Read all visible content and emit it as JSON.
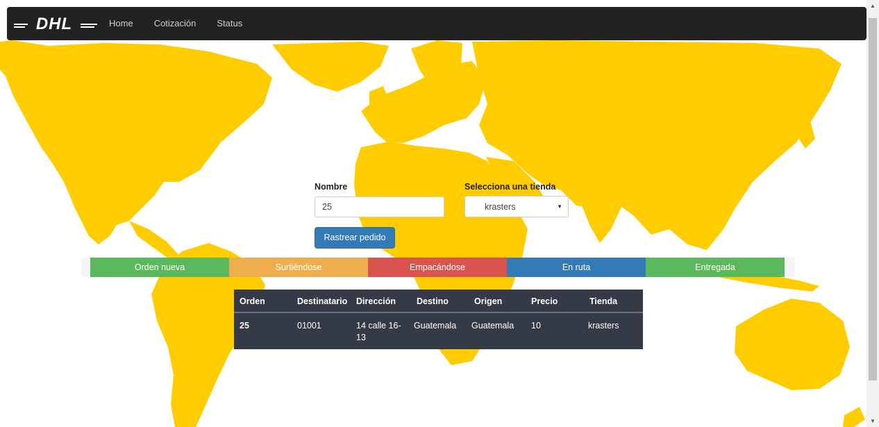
{
  "navbar": {
    "brand": "DHL",
    "links": [
      "Home",
      "Cotización",
      "Status"
    ]
  },
  "form": {
    "name_label": "Nombre",
    "name_value": "25",
    "store_label": "Selecciona una tienda",
    "store_value": "krasters",
    "track_button": "Rastrear pedido"
  },
  "status_steps": [
    {
      "label": "Orden nueva",
      "color": "#5cb85c"
    },
    {
      "label": "Surtiéndose",
      "color": "#f0ad4e"
    },
    {
      "label": "Empacándose",
      "color": "#d9534f"
    },
    {
      "label": "En ruta",
      "color": "#337ab7"
    },
    {
      "label": "Entregada",
      "color": "#5cb85c"
    }
  ],
  "table": {
    "headers": [
      "Orden",
      "Destinatario",
      "Dirección",
      "Destino",
      "Origen",
      "Precio",
      "Tienda"
    ],
    "rows": [
      [
        "25",
        "01001",
        "14 calle 16-13",
        "Guatemala",
        "Guatemala",
        "10",
        "krasters"
      ]
    ]
  },
  "colors": {
    "map_land": "#ffcc00",
    "navbar_bg": "#222222",
    "table_bg": "#343a46"
  }
}
